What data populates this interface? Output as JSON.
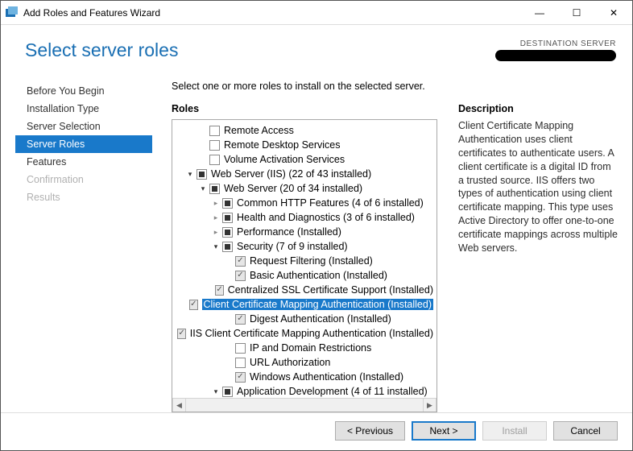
{
  "window": {
    "title": "Add Roles and Features Wizard"
  },
  "header": {
    "page_title": "Select server roles",
    "destination_label": "DESTINATION SERVER"
  },
  "nav": {
    "items": [
      {
        "label": "Before You Begin",
        "state": "normal"
      },
      {
        "label": "Installation Type",
        "state": "normal"
      },
      {
        "label": "Server Selection",
        "state": "normal"
      },
      {
        "label": "Server Roles",
        "state": "active"
      },
      {
        "label": "Features",
        "state": "normal"
      },
      {
        "label": "Confirmation",
        "state": "disabled"
      },
      {
        "label": "Results",
        "state": "disabled"
      }
    ]
  },
  "content": {
    "instruction": "Select one or more roles to install on the selected server.",
    "roles_heading": "Roles",
    "description_heading": "Description",
    "description_text": "Client Certificate Mapping Authentication uses client certificates to authenticate users. A client certificate is a digital ID from a trusted source. IIS offers two types of authentication using client certificate mapping. This type uses Active Directory to offer one-to-one certificate mappings across multiple Web servers."
  },
  "tree": [
    {
      "indent": 2,
      "expander": "none",
      "check": "empty",
      "label": "Remote Access"
    },
    {
      "indent": 2,
      "expander": "none",
      "check": "empty",
      "label": "Remote Desktop Services"
    },
    {
      "indent": 2,
      "expander": "none",
      "check": "empty",
      "label": "Volume Activation Services"
    },
    {
      "indent": 1,
      "expander": "open",
      "check": "indet",
      "label": "Web Server (IIS) (22 of 43 installed)"
    },
    {
      "indent": 2,
      "expander": "open",
      "check": "indet",
      "label": "Web Server (20 of 34 installed)"
    },
    {
      "indent": 3,
      "expander": "closed",
      "check": "indet",
      "label": "Common HTTP Features (4 of 6 installed)"
    },
    {
      "indent": 3,
      "expander": "closed",
      "check": "indet",
      "label": "Health and Diagnostics (3 of 6 installed)"
    },
    {
      "indent": 3,
      "expander": "closed",
      "check": "indet",
      "label": "Performance (Installed)"
    },
    {
      "indent": 3,
      "expander": "open",
      "check": "indet",
      "label": "Security (7 of 9 installed)"
    },
    {
      "indent": 4,
      "expander": "none",
      "check": "checked",
      "label": "Request Filtering (Installed)"
    },
    {
      "indent": 4,
      "expander": "none",
      "check": "checked",
      "label": "Basic Authentication (Installed)"
    },
    {
      "indent": 4,
      "expander": "none",
      "check": "checked",
      "label": "Centralized SSL Certificate Support (Installed)"
    },
    {
      "indent": 4,
      "expander": "none",
      "check": "checked",
      "label": "Client Certificate Mapping Authentication (Installed)",
      "selected": true
    },
    {
      "indent": 4,
      "expander": "none",
      "check": "checked",
      "label": "Digest Authentication (Installed)"
    },
    {
      "indent": 4,
      "expander": "none",
      "check": "checked",
      "label": "IIS Client Certificate Mapping Authentication (Installed)"
    },
    {
      "indent": 4,
      "expander": "none",
      "check": "empty",
      "label": "IP and Domain Restrictions"
    },
    {
      "indent": 4,
      "expander": "none",
      "check": "empty",
      "label": "URL Authorization"
    },
    {
      "indent": 4,
      "expander": "none",
      "check": "checked",
      "label": "Windows Authentication (Installed)"
    },
    {
      "indent": 3,
      "expander": "open",
      "check": "indet",
      "label": "Application Development (4 of 11 installed)"
    }
  ],
  "footer": {
    "previous": "< Previous",
    "next": "Next >",
    "install": "Install",
    "cancel": "Cancel"
  }
}
